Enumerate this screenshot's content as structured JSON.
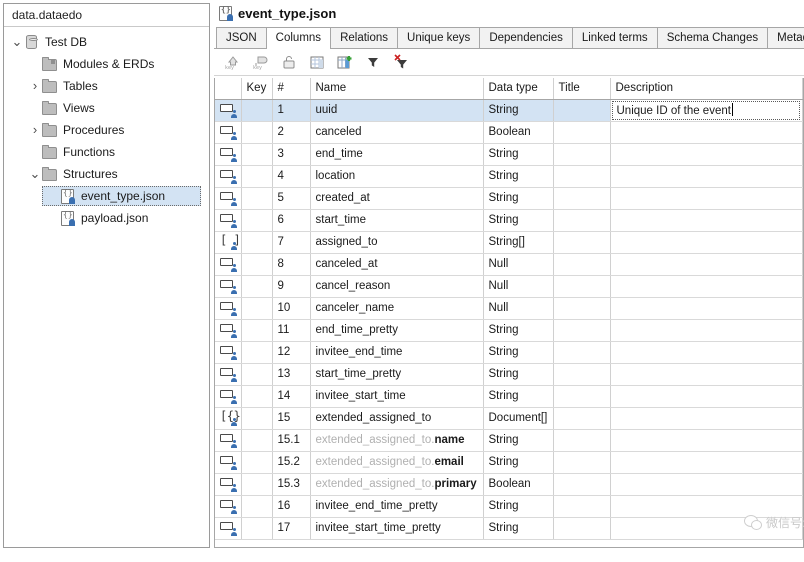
{
  "sidebar": {
    "header": "data.dataedo",
    "items": [
      {
        "label": "Test DB",
        "indent": 0,
        "twisty": "v",
        "icon": "database-icon",
        "selected": false
      },
      {
        "label": "Modules & ERDs",
        "indent": 1,
        "twisty": "",
        "icon": "folder-marked-icon",
        "selected": false
      },
      {
        "label": "Tables",
        "indent": 1,
        "twisty": ">",
        "icon": "folder-icon",
        "selected": false
      },
      {
        "label": "Views",
        "indent": 1,
        "twisty": "",
        "icon": "folder-icon",
        "selected": false
      },
      {
        "label": "Procedures",
        "indent": 1,
        "twisty": ">",
        "icon": "folder-icon",
        "selected": false
      },
      {
        "label": "Functions",
        "indent": 1,
        "twisty": "",
        "icon": "folder-icon",
        "selected": false
      },
      {
        "label": "Structures",
        "indent": 1,
        "twisty": "v",
        "icon": "folder-icon",
        "selected": false
      },
      {
        "label": "event_type.json",
        "indent": 2,
        "twisty": "",
        "icon": "structure-icon",
        "selected": true
      },
      {
        "label": "payload.json",
        "indent": 2,
        "twisty": "",
        "icon": "structure-icon",
        "selected": false
      }
    ]
  },
  "document": {
    "title": "event_type.json",
    "icon": "structure-icon"
  },
  "tabs": [
    {
      "label": "JSON",
      "active": false
    },
    {
      "label": "Columns",
      "active": true
    },
    {
      "label": "Relations",
      "active": false
    },
    {
      "label": "Unique keys",
      "active": false
    },
    {
      "label": "Dependencies",
      "active": false
    },
    {
      "label": "Linked terms",
      "active": false
    },
    {
      "label": "Schema Changes",
      "active": false
    },
    {
      "label": "Metadata",
      "active": false
    }
  ],
  "toolbar": {
    "buttons": [
      {
        "name": "add-primary-key-icon",
        "glyph": "key-up"
      },
      {
        "name": "add-foreign-key-icon",
        "glyph": "key-down"
      },
      {
        "name": "unlock-icon",
        "glyph": "lock"
      },
      {
        "name": "table-columns-icon",
        "glyph": "grid"
      },
      {
        "name": "add-column-icon",
        "glyph": "grid-plus"
      },
      {
        "name": "filter-icon",
        "glyph": "filter"
      },
      {
        "name": "clear-filter-icon",
        "glyph": "filter-x"
      }
    ]
  },
  "grid": {
    "headers": {
      "icon": "",
      "key": "Key",
      "number": "#",
      "name": "Name",
      "datatype": "Data type",
      "title": "Title",
      "description": "Description"
    },
    "editing_cell": {
      "row": 1,
      "column": "description",
      "value": "Unique ID of the event"
    },
    "rows": [
      {
        "icon": "field-icon",
        "key": "",
        "num": "1",
        "name": "uuid",
        "prefix": "",
        "type": "String",
        "title": "",
        "desc": "Unique ID of the event",
        "selected": true,
        "editing": true
      },
      {
        "icon": "field-icon",
        "key": "",
        "num": "2",
        "name": "canceled",
        "prefix": "",
        "type": "Boolean",
        "title": "",
        "desc": "",
        "selected": false,
        "editing": false
      },
      {
        "icon": "field-icon",
        "key": "",
        "num": "3",
        "name": "end_time",
        "prefix": "",
        "type": "String",
        "title": "",
        "desc": "",
        "selected": false,
        "editing": false
      },
      {
        "icon": "field-icon",
        "key": "",
        "num": "4",
        "name": "location",
        "prefix": "",
        "type": "String",
        "title": "",
        "desc": "",
        "selected": false,
        "editing": false
      },
      {
        "icon": "field-icon",
        "key": "",
        "num": "5",
        "name": "created_at",
        "prefix": "",
        "type": "String",
        "title": "",
        "desc": "",
        "selected": false,
        "editing": false
      },
      {
        "icon": "field-icon",
        "key": "",
        "num": "6",
        "name": "start_time",
        "prefix": "",
        "type": "String",
        "title": "",
        "desc": "",
        "selected": false,
        "editing": false
      },
      {
        "icon": "array-icon",
        "key": "",
        "num": "7",
        "name": "assigned_to",
        "prefix": "",
        "type": "String[]",
        "title": "",
        "desc": "",
        "selected": false,
        "editing": false
      },
      {
        "icon": "field-icon",
        "key": "",
        "num": "8",
        "name": "canceled_at",
        "prefix": "",
        "type": "Null",
        "title": "",
        "desc": "",
        "selected": false,
        "editing": false
      },
      {
        "icon": "field-icon",
        "key": "",
        "num": "9",
        "name": "cancel_reason",
        "prefix": "",
        "type": "Null",
        "title": "",
        "desc": "",
        "selected": false,
        "editing": false
      },
      {
        "icon": "field-icon",
        "key": "",
        "num": "10",
        "name": "canceler_name",
        "prefix": "",
        "type": "Null",
        "title": "",
        "desc": "",
        "selected": false,
        "editing": false
      },
      {
        "icon": "field-icon",
        "key": "",
        "num": "11",
        "name": "end_time_pretty",
        "prefix": "",
        "type": "String",
        "title": "",
        "desc": "",
        "selected": false,
        "editing": false
      },
      {
        "icon": "field-icon",
        "key": "",
        "num": "12",
        "name": "invitee_end_time",
        "prefix": "",
        "type": "String",
        "title": "",
        "desc": "",
        "selected": false,
        "editing": false
      },
      {
        "icon": "field-icon",
        "key": "",
        "num": "13",
        "name": "start_time_pretty",
        "prefix": "",
        "type": "String",
        "title": "",
        "desc": "",
        "selected": false,
        "editing": false
      },
      {
        "icon": "field-icon",
        "key": "",
        "num": "14",
        "name": "invitee_start_time",
        "prefix": "",
        "type": "String",
        "title": "",
        "desc": "",
        "selected": false,
        "editing": false
      },
      {
        "icon": "document-array-icon",
        "key": "",
        "num": "15",
        "name": "extended_assigned_to",
        "prefix": "",
        "type": "Document[]",
        "title": "",
        "desc": "",
        "selected": false,
        "editing": false
      },
      {
        "icon": "field-icon",
        "key": "",
        "num": "15.1",
        "name": "name",
        "prefix": "extended_assigned_to.",
        "type": "String",
        "title": "",
        "desc": "",
        "selected": false,
        "editing": false
      },
      {
        "icon": "field-icon",
        "key": "",
        "num": "15.2",
        "name": "email",
        "prefix": "extended_assigned_to.",
        "type": "String",
        "title": "",
        "desc": "",
        "selected": false,
        "editing": false
      },
      {
        "icon": "field-icon",
        "key": "",
        "num": "15.3",
        "name": "primary",
        "prefix": "extended_assigned_to.",
        "type": "Boolean",
        "title": "",
        "desc": "",
        "selected": false,
        "editing": false
      },
      {
        "icon": "field-icon",
        "key": "",
        "num": "16",
        "name": "invitee_end_time_pretty",
        "prefix": "",
        "type": "String",
        "title": "",
        "desc": "",
        "selected": false,
        "editing": false
      },
      {
        "icon": "field-icon",
        "key": "",
        "num": "17",
        "name": "invitee_start_time_pretty",
        "prefix": "",
        "type": "String",
        "title": "",
        "desc": "",
        "selected": false,
        "editing": false
      }
    ]
  },
  "watermark": {
    "text": "微信号: cogitosoftware",
    "logo": "wechat-icon"
  },
  "colors": {
    "selection": "#d3e3f3",
    "accent": "#3a6fb0",
    "border": "#a6a6a6",
    "watermark": "#c9c9c9"
  }
}
